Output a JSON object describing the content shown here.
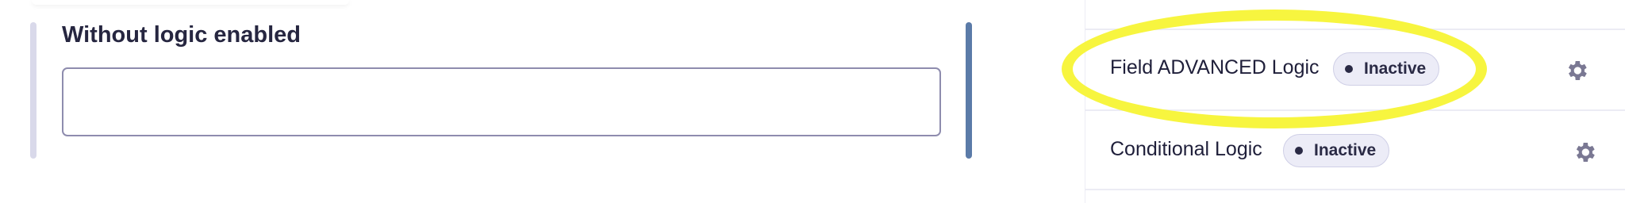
{
  "editor": {
    "field_label": "Without logic enabled",
    "field_value": ""
  },
  "panel": {
    "rows": [
      {
        "label": "Field ADVANCED Logic",
        "status": "Inactive",
        "icon": "gear-icon"
      },
      {
        "label": "Conditional Logic",
        "status": "Inactive",
        "icon": "gear-icon"
      }
    ]
  },
  "colors": {
    "highlight": "#f7f53f",
    "accent_active": "#5b7ba8",
    "accent_inactive": "#d9d9ea",
    "badge_bg": "#ececf7"
  }
}
